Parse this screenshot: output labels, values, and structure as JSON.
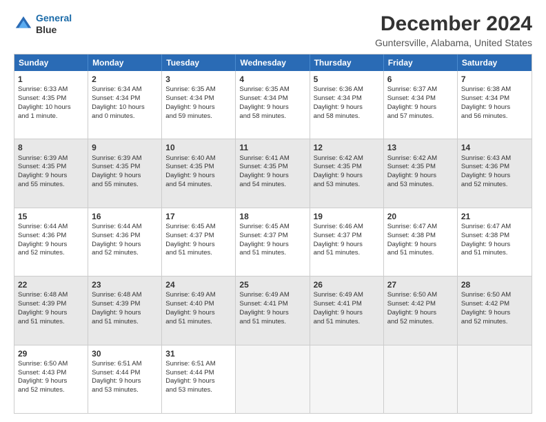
{
  "header": {
    "logo_line1": "General",
    "logo_line2": "Blue",
    "main_title": "December 2024",
    "subtitle": "Guntersville, Alabama, United States"
  },
  "weekdays": [
    "Sunday",
    "Monday",
    "Tuesday",
    "Wednesday",
    "Thursday",
    "Friday",
    "Saturday"
  ],
  "weeks": [
    [
      {
        "day": "1",
        "lines": [
          "Sunrise: 6:33 AM",
          "Sunset: 4:35 PM",
          "Daylight: 10 hours",
          "and 1 minute."
        ],
        "shaded": false
      },
      {
        "day": "2",
        "lines": [
          "Sunrise: 6:34 AM",
          "Sunset: 4:34 PM",
          "Daylight: 10 hours",
          "and 0 minutes."
        ],
        "shaded": false
      },
      {
        "day": "3",
        "lines": [
          "Sunrise: 6:35 AM",
          "Sunset: 4:34 PM",
          "Daylight: 9 hours",
          "and 59 minutes."
        ],
        "shaded": false
      },
      {
        "day": "4",
        "lines": [
          "Sunrise: 6:35 AM",
          "Sunset: 4:34 PM",
          "Daylight: 9 hours",
          "and 58 minutes."
        ],
        "shaded": false
      },
      {
        "day": "5",
        "lines": [
          "Sunrise: 6:36 AM",
          "Sunset: 4:34 PM",
          "Daylight: 9 hours",
          "and 58 minutes."
        ],
        "shaded": false
      },
      {
        "day": "6",
        "lines": [
          "Sunrise: 6:37 AM",
          "Sunset: 4:34 PM",
          "Daylight: 9 hours",
          "and 57 minutes."
        ],
        "shaded": false
      },
      {
        "day": "7",
        "lines": [
          "Sunrise: 6:38 AM",
          "Sunset: 4:34 PM",
          "Daylight: 9 hours",
          "and 56 minutes."
        ],
        "shaded": false
      }
    ],
    [
      {
        "day": "8",
        "lines": [
          "Sunrise: 6:39 AM",
          "Sunset: 4:35 PM",
          "Daylight: 9 hours",
          "and 55 minutes."
        ],
        "shaded": true
      },
      {
        "day": "9",
        "lines": [
          "Sunrise: 6:39 AM",
          "Sunset: 4:35 PM",
          "Daylight: 9 hours",
          "and 55 minutes."
        ],
        "shaded": true
      },
      {
        "day": "10",
        "lines": [
          "Sunrise: 6:40 AM",
          "Sunset: 4:35 PM",
          "Daylight: 9 hours",
          "and 54 minutes."
        ],
        "shaded": true
      },
      {
        "day": "11",
        "lines": [
          "Sunrise: 6:41 AM",
          "Sunset: 4:35 PM",
          "Daylight: 9 hours",
          "and 54 minutes."
        ],
        "shaded": true
      },
      {
        "day": "12",
        "lines": [
          "Sunrise: 6:42 AM",
          "Sunset: 4:35 PM",
          "Daylight: 9 hours",
          "and 53 minutes."
        ],
        "shaded": true
      },
      {
        "day": "13",
        "lines": [
          "Sunrise: 6:42 AM",
          "Sunset: 4:35 PM",
          "Daylight: 9 hours",
          "and 53 minutes."
        ],
        "shaded": true
      },
      {
        "day": "14",
        "lines": [
          "Sunrise: 6:43 AM",
          "Sunset: 4:36 PM",
          "Daylight: 9 hours",
          "and 52 minutes."
        ],
        "shaded": true
      }
    ],
    [
      {
        "day": "15",
        "lines": [
          "Sunrise: 6:44 AM",
          "Sunset: 4:36 PM",
          "Daylight: 9 hours",
          "and 52 minutes."
        ],
        "shaded": false
      },
      {
        "day": "16",
        "lines": [
          "Sunrise: 6:44 AM",
          "Sunset: 4:36 PM",
          "Daylight: 9 hours",
          "and 52 minutes."
        ],
        "shaded": false
      },
      {
        "day": "17",
        "lines": [
          "Sunrise: 6:45 AM",
          "Sunset: 4:37 PM",
          "Daylight: 9 hours",
          "and 51 minutes."
        ],
        "shaded": false
      },
      {
        "day": "18",
        "lines": [
          "Sunrise: 6:45 AM",
          "Sunset: 4:37 PM",
          "Daylight: 9 hours",
          "and 51 minutes."
        ],
        "shaded": false
      },
      {
        "day": "19",
        "lines": [
          "Sunrise: 6:46 AM",
          "Sunset: 4:37 PM",
          "Daylight: 9 hours",
          "and 51 minutes."
        ],
        "shaded": false
      },
      {
        "day": "20",
        "lines": [
          "Sunrise: 6:47 AM",
          "Sunset: 4:38 PM",
          "Daylight: 9 hours",
          "and 51 minutes."
        ],
        "shaded": false
      },
      {
        "day": "21",
        "lines": [
          "Sunrise: 6:47 AM",
          "Sunset: 4:38 PM",
          "Daylight: 9 hours",
          "and 51 minutes."
        ],
        "shaded": false
      }
    ],
    [
      {
        "day": "22",
        "lines": [
          "Sunrise: 6:48 AM",
          "Sunset: 4:39 PM",
          "Daylight: 9 hours",
          "and 51 minutes."
        ],
        "shaded": true
      },
      {
        "day": "23",
        "lines": [
          "Sunrise: 6:48 AM",
          "Sunset: 4:39 PM",
          "Daylight: 9 hours",
          "and 51 minutes."
        ],
        "shaded": true
      },
      {
        "day": "24",
        "lines": [
          "Sunrise: 6:49 AM",
          "Sunset: 4:40 PM",
          "Daylight: 9 hours",
          "and 51 minutes."
        ],
        "shaded": true
      },
      {
        "day": "25",
        "lines": [
          "Sunrise: 6:49 AM",
          "Sunset: 4:41 PM",
          "Daylight: 9 hours",
          "and 51 minutes."
        ],
        "shaded": true
      },
      {
        "day": "26",
        "lines": [
          "Sunrise: 6:49 AM",
          "Sunset: 4:41 PM",
          "Daylight: 9 hours",
          "and 51 minutes."
        ],
        "shaded": true
      },
      {
        "day": "27",
        "lines": [
          "Sunrise: 6:50 AM",
          "Sunset: 4:42 PM",
          "Daylight: 9 hours",
          "and 52 minutes."
        ],
        "shaded": true
      },
      {
        "day": "28",
        "lines": [
          "Sunrise: 6:50 AM",
          "Sunset: 4:42 PM",
          "Daylight: 9 hours",
          "and 52 minutes."
        ],
        "shaded": true
      }
    ],
    [
      {
        "day": "29",
        "lines": [
          "Sunrise: 6:50 AM",
          "Sunset: 4:43 PM",
          "Daylight: 9 hours",
          "and 52 minutes."
        ],
        "shaded": false
      },
      {
        "day": "30",
        "lines": [
          "Sunrise: 6:51 AM",
          "Sunset: 4:44 PM",
          "Daylight: 9 hours",
          "and 53 minutes."
        ],
        "shaded": false
      },
      {
        "day": "31",
        "lines": [
          "Sunrise: 6:51 AM",
          "Sunset: 4:44 PM",
          "Daylight: 9 hours",
          "and 53 minutes."
        ],
        "shaded": false
      },
      {
        "day": "",
        "lines": [],
        "shaded": false,
        "empty": true
      },
      {
        "day": "",
        "lines": [],
        "shaded": false,
        "empty": true
      },
      {
        "day": "",
        "lines": [],
        "shaded": false,
        "empty": true
      },
      {
        "day": "",
        "lines": [],
        "shaded": false,
        "empty": true
      }
    ]
  ]
}
